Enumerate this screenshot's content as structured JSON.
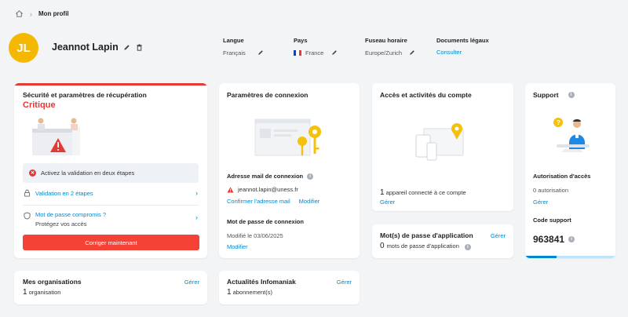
{
  "breadcrumb": {
    "current": "Mon profil"
  },
  "profile": {
    "initials": "JL",
    "name": "Jeannot Lapin",
    "avatar_color": "#f5b800",
    "fields": [
      {
        "label": "Langue",
        "value": "Français"
      },
      {
        "label": "Pays",
        "value": "France"
      },
      {
        "label": "Fuseau horaire",
        "value": "Europe/Zurich"
      },
      {
        "label": "Documents légaux",
        "value": "Consulter"
      }
    ]
  },
  "security": {
    "title": "Sécurité et paramètres de récupération",
    "status": "Critique",
    "status_color": "#e53935",
    "alert_text": "Activez la validation en deux étapes",
    "item_2fa": "Validation en 2 étapes",
    "item_password": "Mot de passe compromis ?",
    "item_password_sub": "Protégez vos accès",
    "fix_button": "Corriger maintenant"
  },
  "connection": {
    "title": "Paramètres de connexion",
    "email_label": "Adresse mail de connexion",
    "email": "jeannot.lapin@uness.fr",
    "confirm_link": "Confirmer l'adresse mail",
    "modify_link": "Modifier",
    "password_label": "Mot de passe de connexion",
    "password_modified": "Modifié le 03/06/2025",
    "password_modify_link": "Modifier"
  },
  "access": {
    "title": "Accès et activités du compte",
    "count": "1",
    "count_text": "appareil connecté à ce compte",
    "manage_link": "Gérer"
  },
  "app_passwords": {
    "title": "Mot(s) de passe d'application",
    "manage_link": "Gérer",
    "count": "0",
    "count_text": "mots de passe d'application"
  },
  "support": {
    "title": "Support",
    "auth_label": "Autorisation d'accès",
    "auth_value": "0 autorisation",
    "manage_link": "Gérer",
    "code_label": "Code support",
    "code": "963841"
  },
  "organisations": {
    "title": "Mes organisations",
    "manage_link": "Gérer",
    "count": "1",
    "count_text": "organisation"
  },
  "news": {
    "title": "Actualités Infomaniak",
    "manage_link": "Gérer",
    "count": "1",
    "count_text": "abonnement(s)"
  }
}
